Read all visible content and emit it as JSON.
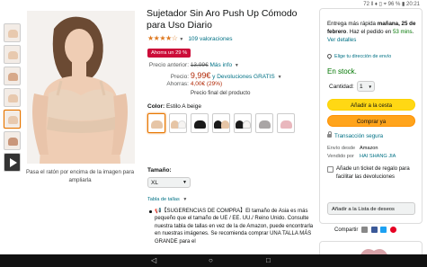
{
  "status_bar": {
    "text": "72 ll ♦ ▯ ⌖ 96 % ▮ 20:21"
  },
  "gallery": {
    "hover_note": "Pasa el ratón por encima de la imagen para ampliarla"
  },
  "product": {
    "title": "Sujetador Sin Aro Push Up Cómodo para Uso Diario",
    "rating_stars": "★★★★☆",
    "ratings_link": "109 valoraciones",
    "deal_badge": "Ahorra un 29 %"
  },
  "pricing": {
    "previous_label": "Precio anterior:",
    "previous_value": "13,99€",
    "info_link": "Más info",
    "price_label": "Precio:",
    "price_value": "9,99€",
    "returns_link": "y Devoluciones GRATIS",
    "savings_label": "Ahorras:",
    "savings_value": "4,00€ (29%)",
    "final_note": "Precio final del producto"
  },
  "color": {
    "label": "Color:",
    "value": "Estilo A beige",
    "swatches": [
      "beige",
      "beige-set",
      "black",
      "black-beige",
      "black-white",
      "gray",
      "pink"
    ],
    "colors": {
      "beige": "#e6c5a6",
      "black": "#1a1a1a",
      "gray": "#a9a5a5",
      "pink": "#e9b7bd",
      "white": "#f6f4f2"
    }
  },
  "size": {
    "label": "Tamaño:",
    "selected": "XL",
    "table_link": "Tabla de tallas"
  },
  "bullet": {
    "text": "📢【SUGERENCIAS DE COMPRA】El tamaño de Asia es más pequeño que el tamaño de UE / EE. UU./ Reino Unido. Consulte nuestra tabla de tallas en vez de la de Amazon, puede encontrarla en nuestras imágenes. Se recomienda comprar UNA TALLA MÁS GRANDE para el"
  },
  "buybox": {
    "delivery_prefix": "Entrega más rápida",
    "delivery_date": "mañana, 25 de febrero",
    "delivery_middle": ". Haz el pedido en",
    "delivery_countdown": "53 mins",
    "details_link": "Ver detalles",
    "address_link": "Elige tu dirección de envío",
    "stock": "En stock.",
    "qty_label": "Cantidad:",
    "qty_value": "1",
    "add_to_cart": "Añadir a la cesta",
    "buy_now": "Comprar ya",
    "secure_link": "Transacción segura",
    "ship_from_label": "Envío desde",
    "ship_from_value": "Amazon",
    "sold_by_label": "Vendido por",
    "sold_by_value": "HAI SHANG JIA",
    "gift_text": "Añade un ticket de regalo para facilitar las devoluciones",
    "wishlist_button": "Añadir a la Lista de deseos",
    "share_label": "Compartir"
  },
  "accent": {
    "link": "#007185",
    "price": "#b12704",
    "deal": "#cc0c39",
    "cart": "#ffd814",
    "buy": "#ffa41c",
    "stock": "#007600"
  }
}
